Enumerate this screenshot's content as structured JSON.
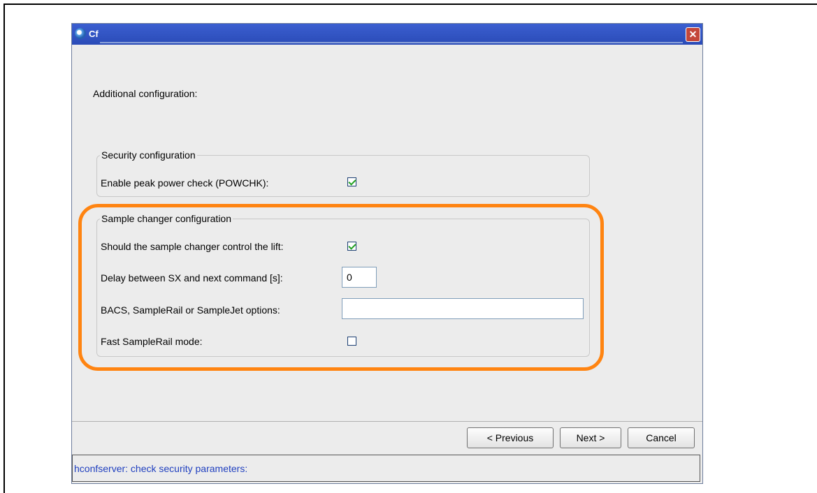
{
  "window": {
    "title": "Cf",
    "close_label": "✕"
  },
  "heading": "Additional configuration:",
  "security": {
    "legend": "Security configuration",
    "power_check_label": "Enable peak power check (POWCHK):",
    "power_check_checked": true
  },
  "sample_changer": {
    "legend": "Sample changer configuration",
    "lift_label": "Should the sample changer control the lift:",
    "lift_checked": true,
    "delay_label": "Delay between SX and next command [s]:",
    "delay_value": "0",
    "options_label": "BACS, SampleRail or SampleJet options:",
    "options_value": "",
    "fast_mode_label": "Fast SampleRail mode:",
    "fast_mode_checked": false
  },
  "buttons": {
    "previous": "< Previous",
    "next": "Next >",
    "cancel": "Cancel"
  },
  "status": "hconfserver: check security parameters:",
  "colors": {
    "highlight": "#ff8411",
    "titlebar": "#2a4bb7",
    "status_text": "#1f3fbf"
  }
}
